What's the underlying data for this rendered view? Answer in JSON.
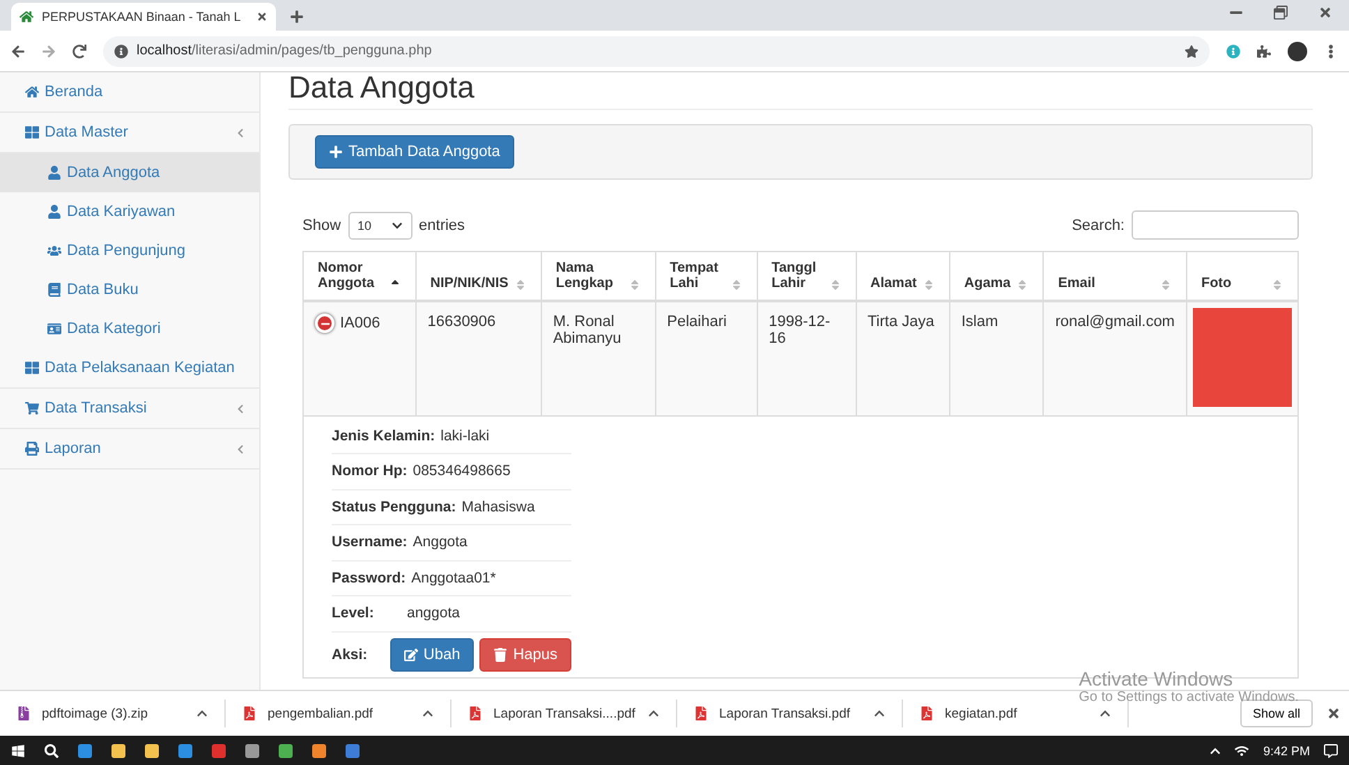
{
  "browser": {
    "tab_title": "PERPUSTAKAAN Binaan - Tanah L",
    "url_host": "localhost",
    "url_path": "/literasi/admin/pages/tb_pengguna.php"
  },
  "sidebar": {
    "items": [
      {
        "label": "Beranda",
        "selected": false,
        "expandable": false
      },
      {
        "label": "Data Master",
        "selected": false,
        "expandable": true,
        "children": [
          {
            "label": "Data Anggota",
            "selected": true
          },
          {
            "label": "Data Kariyawan",
            "selected": false
          },
          {
            "label": "Data Pengunjung",
            "selected": false
          },
          {
            "label": "Data Buku",
            "selected": false
          },
          {
            "label": "Data Kategori",
            "selected": false
          }
        ]
      },
      {
        "label": "Data Pelaksanaan Kegiatan",
        "selected": false,
        "expandable": false
      },
      {
        "label": "Data Transaksi",
        "selected": false,
        "expandable": true
      },
      {
        "label": "Laporan",
        "selected": false,
        "expandable": true
      }
    ]
  },
  "page_title": "Data Anggota",
  "add_button": "Tambah Data Anggota",
  "length": {
    "show": "Show",
    "value": "10",
    "entries": "entries"
  },
  "search": {
    "label": "Search:"
  },
  "table": {
    "columns": [
      {
        "label": "Nomor Anggota",
        "sorted": true
      },
      {
        "label": "NIP/NIK/NIS",
        "sorted": false
      },
      {
        "label": "Nama Lengkap",
        "sorted": false
      },
      {
        "label": "Tempat Lahi",
        "sorted": false
      },
      {
        "label": "Tanggl Lahir",
        "sorted": false
      },
      {
        "label": "Alamat",
        "sorted": false
      },
      {
        "label": "Agama",
        "sorted": false
      },
      {
        "label": "Email",
        "sorted": false
      },
      {
        "label": "Foto",
        "sorted": false
      }
    ],
    "rows": [
      {
        "expanded": true,
        "cells": [
          "IA006",
          "16630906",
          "M. Ronal Abimanyu",
          "Pelaihari",
          "1998-12-16",
          "Tirta Jaya",
          "Islam",
          "ronal@gmail.com"
        ],
        "details": [
          {
            "label": "Jenis Kelamin:",
            "value": "laki-laki"
          },
          {
            "label": "Nomor Hp:",
            "value": "085346498665"
          },
          {
            "label": "Status Pengguna:",
            "value": "Mahasiswa"
          },
          {
            "label": "Username:",
            "value": "Anggota"
          },
          {
            "label": "Password:",
            "value": "Anggotaa01*"
          },
          {
            "label": "Level:",
            "value": "anggota"
          }
        ],
        "actions_label": "Aksi:",
        "actions": [
          {
            "label": "Ubah",
            "kind": "edit"
          },
          {
            "label": "Hapus",
            "kind": "delete"
          }
        ]
      }
    ]
  },
  "activation": {
    "title": "Activate Windows",
    "subtitle": "Go to Settings to activate Windows."
  },
  "downloads": {
    "items": [
      {
        "name": "pdftoimage (3).zip",
        "kind": "zip"
      },
      {
        "name": "pengembalian.pdf",
        "kind": "pdf"
      },
      {
        "name": "Laporan Transaksi....pdf",
        "kind": "pdf"
      },
      {
        "name": "Laporan Transaksi.pdf",
        "kind": "pdf"
      },
      {
        "name": "kegiatan.pdf",
        "kind": "pdf"
      }
    ],
    "show_all": "Show all"
  },
  "taskbar": {
    "time": "9:42 PM"
  }
}
